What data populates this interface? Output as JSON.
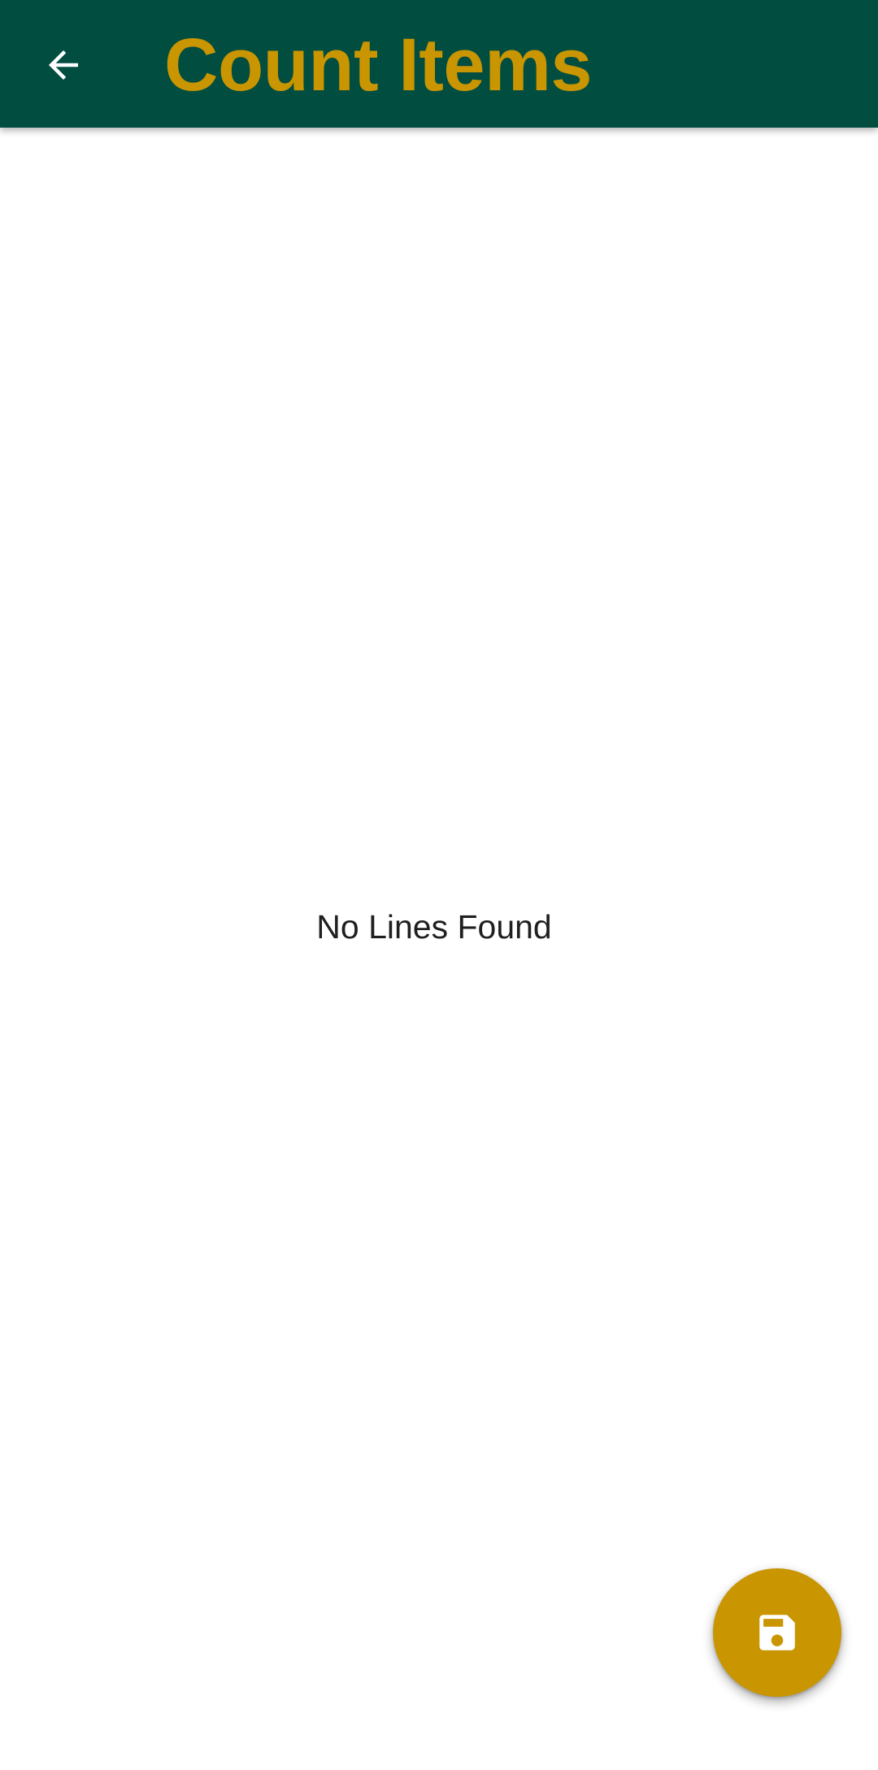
{
  "app_bar": {
    "title": "Count Items",
    "back_icon": "arrow-back-icon",
    "background_color": "#014d40",
    "title_color": "#c99500"
  },
  "content": {
    "empty_message": "No Lines Found"
  },
  "fab": {
    "icon": "save-icon",
    "background_color": "#c99500"
  }
}
